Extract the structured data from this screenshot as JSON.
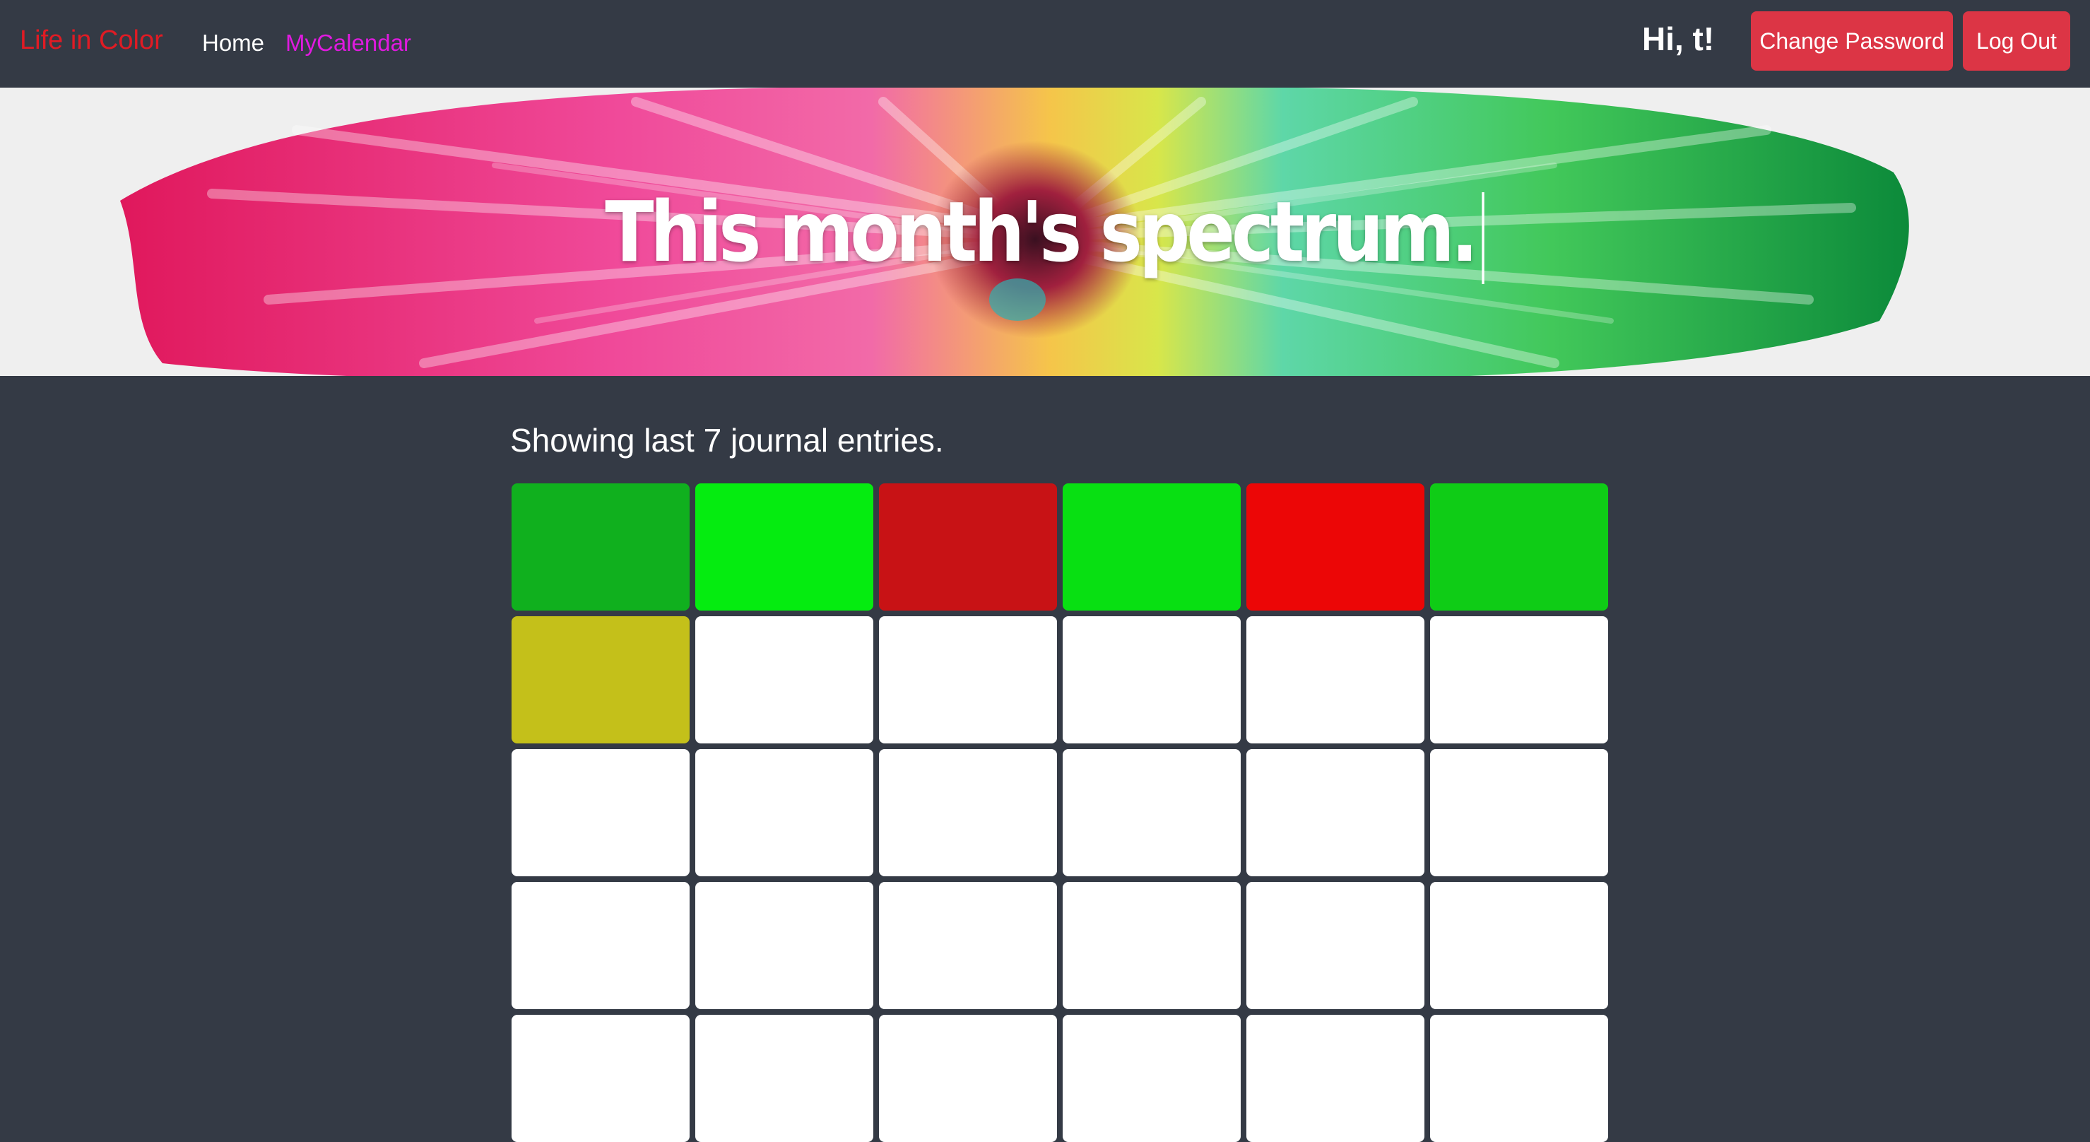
{
  "navbar": {
    "brand": "Life in Color",
    "links": [
      {
        "label": "Home",
        "color": "#ffffff"
      },
      {
        "label": "MyCalendar",
        "color": "#e01ae0"
      }
    ],
    "greeting": "Hi, t!",
    "change_password_label": "Change Password",
    "logout_label": "Log Out",
    "brand_color": "#e01b24",
    "button_color": "#dc3545"
  },
  "banner": {
    "title": "This month's spectrum."
  },
  "main": {
    "heading": "Showing last 7 journal entries.",
    "entries": [
      "#10b01e",
      "#05ec10",
      "#c81215",
      "#08e012",
      "#ec0606",
      "#0fcc16",
      "#c4c01a",
      "#ffffff",
      "#ffffff",
      "#ffffff",
      "#ffffff",
      "#ffffff",
      "#ffffff",
      "#ffffff",
      "#ffffff",
      "#ffffff",
      "#ffffff",
      "#ffffff",
      "#ffffff",
      "#ffffff",
      "#ffffff",
      "#ffffff",
      "#ffffff",
      "#ffffff",
      "#ffffff",
      "#ffffff",
      "#ffffff",
      "#ffffff",
      "#ffffff",
      "#ffffff"
    ]
  }
}
